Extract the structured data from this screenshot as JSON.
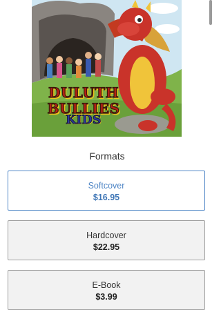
{
  "cover": {
    "title_line1": "DULUTH",
    "title_line2": "BULLIES",
    "title_line3": "KIDS"
  },
  "formats": {
    "heading": "Formats",
    "options": [
      {
        "name": "Softcover",
        "price": "$16.95",
        "selected": true
      },
      {
        "name": "Hardcover",
        "price": "$22.95",
        "selected": false
      },
      {
        "name": "E-Book",
        "price": "$3.99",
        "selected": false
      }
    ]
  },
  "colors": {
    "accent": "#4f86c6",
    "card_background": "#f2f2f2",
    "card_border": "#9e9e9e"
  }
}
